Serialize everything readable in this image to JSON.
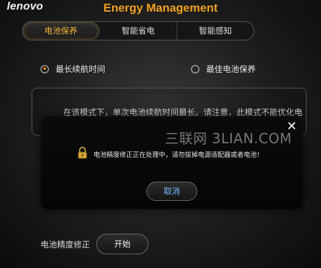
{
  "header": {
    "logo": "lenovo",
    "title": "Energy Management"
  },
  "tabs": [
    {
      "label": "电池保养",
      "active": true
    },
    {
      "label": "智能省电",
      "active": false
    },
    {
      "label": "智能感知",
      "active": false
    }
  ],
  "modes": {
    "option1": "最长续航时间",
    "option2": "最佳电池保养",
    "selected": "最长续航时间"
  },
  "description": "在该模式下，单次电池续航时间最长。请注意，此模式不能优化电",
  "dialog": {
    "message": "电池精度修正正在处理中，请勿拔掉电源适配器或者电池！",
    "cancel_label": "取消",
    "close_glyph": "✕"
  },
  "watermark": "三联网 3LIAN.COM",
  "calibration": {
    "label": "电池精度修正",
    "start_label": "开始"
  },
  "colors": {
    "accent": "#f0a020",
    "cancel_text": "#79b6ff"
  }
}
